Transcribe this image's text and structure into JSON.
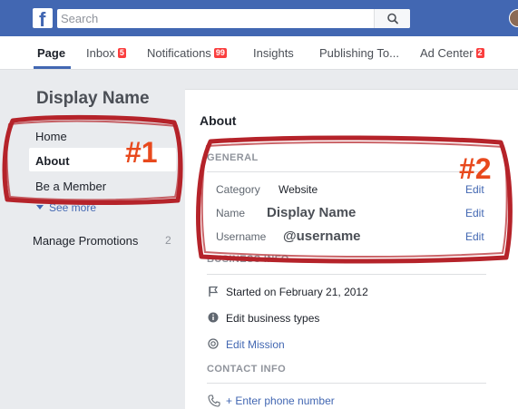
{
  "topbar": {
    "logo_letter": "f",
    "search_placeholder": "Search"
  },
  "tabs": [
    {
      "label": "Page",
      "badge": ""
    },
    {
      "label": "Inbox",
      "badge": "5"
    },
    {
      "label": "Notifications",
      "badge": "99"
    },
    {
      "label": "Insights",
      "badge": ""
    },
    {
      "label": "Publishing To...",
      "badge": ""
    },
    {
      "label": "Ad Center",
      "badge": "2"
    }
  ],
  "sidebar": {
    "page_name": "Display Name",
    "items": [
      {
        "label": "Home"
      },
      {
        "label": "About"
      },
      {
        "label": "Be a Member"
      }
    ],
    "see_more": "See more",
    "manage_promotions": "Manage Promotions",
    "manage_promotions_count": "2"
  },
  "main": {
    "title": "About",
    "general": {
      "heading": "GENERAL",
      "rows": [
        {
          "label": "Category",
          "value": "Website",
          "action": "Edit"
        },
        {
          "label": "Name",
          "value": "Display Name",
          "action": "Edit"
        },
        {
          "label": "Username",
          "value": "@username",
          "action": "Edit"
        }
      ]
    },
    "business_info": {
      "heading": "BUSINESS INFO",
      "items": [
        {
          "icon": "flag-icon",
          "text": "Started on February 21, 2012"
        },
        {
          "icon": "info-circle-icon",
          "text": "Edit business types"
        },
        {
          "icon": "mission-icon",
          "text": "Edit Mission"
        }
      ]
    },
    "contact_info": {
      "heading": "CONTACT INFO",
      "items": [
        {
          "icon": "phone-icon",
          "text": "+ Enter phone number"
        }
      ]
    }
  },
  "annotations": {
    "label_1": "#1",
    "label_2": "#2",
    "color": "#b5232a"
  },
  "colors": {
    "brand": "#4267b2",
    "badge": "#fa3e3e",
    "link": "#4267b2"
  }
}
